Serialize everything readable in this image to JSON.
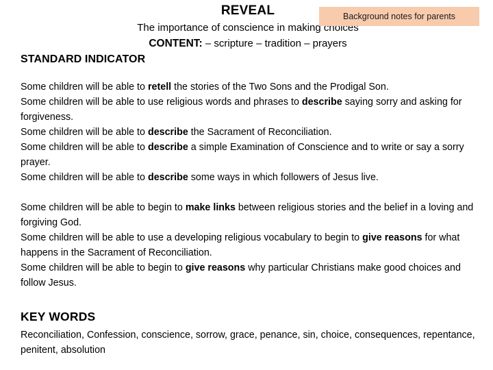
{
  "slide": {
    "title": "REVEAL",
    "subtitle": "The importance of conscience in making choices",
    "content": {
      "label": "CONTENT:",
      "items": " – scripture – tradition – prayers"
    },
    "standard_indicator_heading": "STANDARD INDICATOR",
    "badge": {
      "label": "Background notes for parents",
      "background_color": "#F8CBAD",
      "text_color": "#1A1A1A"
    }
  },
  "body": {
    "paragraphs": [
      {
        "id": "paragraph-standard-indicators",
        "segments": [
          {
            "text": "Some children will be able to ",
            "bold": false
          },
          {
            "text": "retell",
            "bold": true
          },
          {
            "text": " the stories of the Two Sons and the Prodigal Son.",
            "bold": false
          },
          {
            "text": "\n",
            "bold": false
          },
          {
            "text": "Some children will be able to use religious words and phrases to ",
            "bold": false
          },
          {
            "text": "describe",
            "bold": true
          },
          {
            "text": " saying sorry and asking for forgiveness.",
            "bold": false
          },
          {
            "text": "\n",
            "bold": false
          },
          {
            "text": "Some children will be able to ",
            "bold": false
          },
          {
            "text": "describe",
            "bold": true
          },
          {
            "text": " the Sacrament of Reconciliation.",
            "bold": false
          },
          {
            "text": "\n",
            "bold": false
          },
          {
            "text": "Some children will be able to ",
            "bold": false
          },
          {
            "text": "describe",
            "bold": true
          },
          {
            "text": " a simple Examination of Conscience and to write or say a sorry prayer.",
            "bold": false
          },
          {
            "text": "\n",
            "bold": false
          },
          {
            "text": "Some children will be able to ",
            "bold": false
          },
          {
            "text": "describe",
            "bold": true
          },
          {
            "text": " some ways in which followers of Jesus live.",
            "bold": false
          }
        ]
      },
      {
        "id": "paragraph-extended-indicators",
        "segments": [
          {
            "text": "Some children will be able to begin to ",
            "bold": false
          },
          {
            "text": "make links",
            "bold": true
          },
          {
            "text": " between religious stories and the belief in a loving and forgiving God.",
            "bold": false
          },
          {
            "text": "\n",
            "bold": false
          },
          {
            "text": "Some children will be able to use a developing religious vocabulary to begin to ",
            "bold": false
          },
          {
            "text": "give reasons",
            "bold": true
          },
          {
            "text": " for what happens in the Sacrament of Reconciliation.",
            "bold": false
          },
          {
            "text": "\n",
            "bold": false
          },
          {
            "text": "Some children will be able to begin to ",
            "bold": false
          },
          {
            "text": "give reasons",
            "bold": true
          },
          {
            "text": " why particular Christians make good choices and follow Jesus.",
            "bold": false
          }
        ]
      }
    ]
  },
  "keywords": {
    "heading": "KEY WORDS",
    "list": "Reconciliation, Confession, conscience, sorrow, grace, penance, sin, choice, consequences, repentance, penitent, absolution"
  }
}
